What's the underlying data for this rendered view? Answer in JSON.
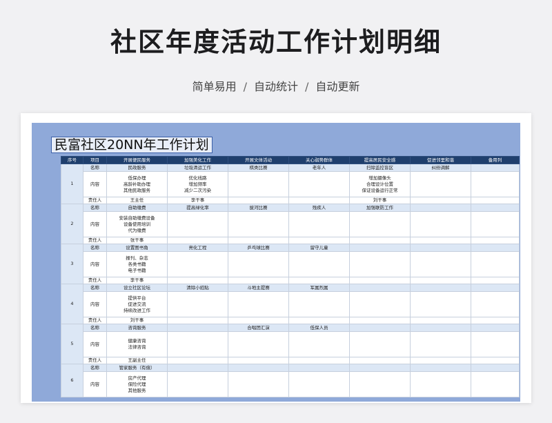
{
  "title": "社区年度活动工作计划明细",
  "subtitle": [
    "简单易用",
    "自动统计",
    "自动更新"
  ],
  "subtitle_separator": "/",
  "sheet": {
    "doc_title": "民富社区20NN年工作计划",
    "header": [
      "序号",
      "项目",
      "开展便民服务",
      "加强美化工作",
      "开展文体活动",
      "关心弱势群体",
      "提高居民安全感",
      "促进邻里和谐",
      "备用列"
    ],
    "row_labels": {
      "name": "名称",
      "content": "内容",
      "owner": "责任人"
    },
    "groups": [
      {
        "idx": "1",
        "names": [
          "民政服务",
          "垃圾清运工作",
          "棋类比赛",
          "老年人",
          "扫除监控盲区",
          "纠纷调解",
          ""
        ],
        "contents": [
          [
            "低保办理",
            "高龄补助办理",
            "其他民政服务"
          ],
          [
            "优化线路",
            "增加频率",
            "减少二次污染"
          ],
          [],
          [],
          [
            "增加摄像头",
            "合理设计位置",
            "保证设备运行正常"
          ],
          [],
          []
        ],
        "owners": [
          "王主任",
          "李干事",
          "",
          "",
          "刘干事",
          "",
          ""
        ]
      },
      {
        "idx": "2",
        "names": [
          "自助缴费",
          "提高绿化率",
          "拔河比赛",
          "残疾人",
          "加强联防工作",
          "",
          ""
        ],
        "contents": [
          [
            "安装自助缴费设备",
            "设备使用培训",
            "代为缴费"
          ],
          [],
          [],
          [],
          [],
          [],
          []
        ],
        "owners": [
          "张干事",
          "",
          "",
          "",
          "",
          "",
          ""
        ]
      },
      {
        "idx": "3",
        "names": [
          "设置图书角",
          "亮化工程",
          "乒乓球比赛",
          "留守儿童",
          "",
          "",
          ""
        ],
        "contents": [
          [
            "报刊、杂志",
            "各类书籍",
            "电子书籍"
          ],
          [],
          [],
          [],
          [],
          [],
          []
        ],
        "owners": [
          "李干事",
          "",
          "",
          "",
          "",
          "",
          ""
        ]
      },
      {
        "idx": "4",
        "names": [
          "设立社区论坛",
          "清除小招贴",
          "斗地主提赛",
          "军属烈属",
          "",
          "",
          ""
        ],
        "contents": [
          [
            "提供平台",
            "促进交流",
            "持续改进工作"
          ],
          [],
          [],
          [],
          [],
          [],
          []
        ],
        "owners": [
          "刘干事",
          "",
          "",
          "",
          "",
          "",
          ""
        ]
      },
      {
        "idx": "5",
        "names": [
          "咨询服务",
          "",
          "合唱团汇演",
          "低保人员",
          "",
          "",
          ""
        ],
        "contents": [
          [
            "健康咨询",
            "法律咨询"
          ],
          [],
          [],
          [],
          [],
          [],
          []
        ],
        "owners": [
          "王副主任",
          "",
          "",
          "",
          "",
          "",
          ""
        ]
      },
      {
        "idx": "6",
        "names": [
          "管家服务（有偿）",
          "",
          "",
          "",
          "",
          "",
          ""
        ],
        "contents": [
          [
            "房产代理",
            "保险代理",
            "其他服务"
          ],
          [],
          [],
          [],
          [],
          [],
          []
        ],
        "owners": null
      }
    ]
  }
}
